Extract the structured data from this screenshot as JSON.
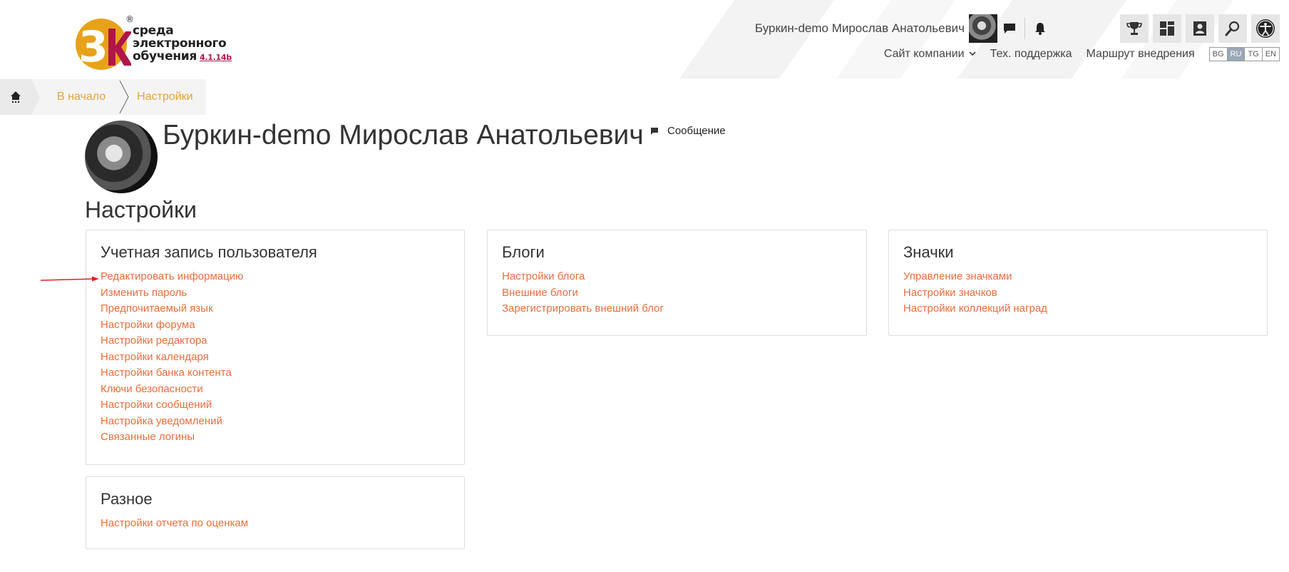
{
  "brand": {
    "logo_lines": [
      "среда",
      "электронного",
      "обучения"
    ],
    "registered": "®",
    "version": "4.1.14b",
    "colors": {
      "orange": "#e8a21a",
      "crimson": "#b0164a",
      "accent_link": "#ea6d3b",
      "breadcrumb": "#e8a23a"
    }
  },
  "header": {
    "user_name": "Буркин-demo Мирослав Анатольевич",
    "icons": {
      "messages": "chat-bubble-icon",
      "notifications": "bell-icon"
    },
    "tools": [
      {
        "name": "trophy-icon"
      },
      {
        "name": "dashboard-grid-icon"
      },
      {
        "name": "user-card-icon"
      },
      {
        "name": "search-icon"
      },
      {
        "name": "accessibility-icon"
      }
    ],
    "nav": {
      "company_site": "Сайт компании",
      "support": "Тех. поддержка",
      "route": "Маршрут внедрения"
    },
    "languages": [
      "BG",
      "RU",
      "TG",
      "EN"
    ],
    "active_language": "RU"
  },
  "breadcrumb": {
    "home_icon": "home-icon",
    "items": [
      "В начало",
      "Настройки"
    ]
  },
  "profile": {
    "name": "Буркин-demo Мирослав Анатольевич",
    "message_label": "Сообщение"
  },
  "page": {
    "title": "Настройки"
  },
  "cards": {
    "account": {
      "title": "Учетная запись пользователя",
      "links": [
        "Редактировать информацию",
        "Изменить пароль",
        "Предпочитаемый язык",
        "Настройки форума",
        "Настройки редактора",
        "Настройки календаря",
        "Настройки банка контента",
        "Ключи безопасности",
        "Настройки сообщений",
        "Настройка уведомлений",
        "Связанные логины"
      ]
    },
    "blogs": {
      "title": "Блоги",
      "links": [
        "Настройки блога",
        "Внешние блоги",
        "Зарегистрировать внешний блог"
      ]
    },
    "badges": {
      "title": "Значки",
      "links": [
        "Управление значками",
        "Настройки значков",
        "Настройки коллекций наград"
      ]
    },
    "misc": {
      "title": "Разное",
      "links": [
        "Настройки отчета по оценкам"
      ]
    }
  },
  "annotation": {
    "arrow_color": "#e02020"
  }
}
